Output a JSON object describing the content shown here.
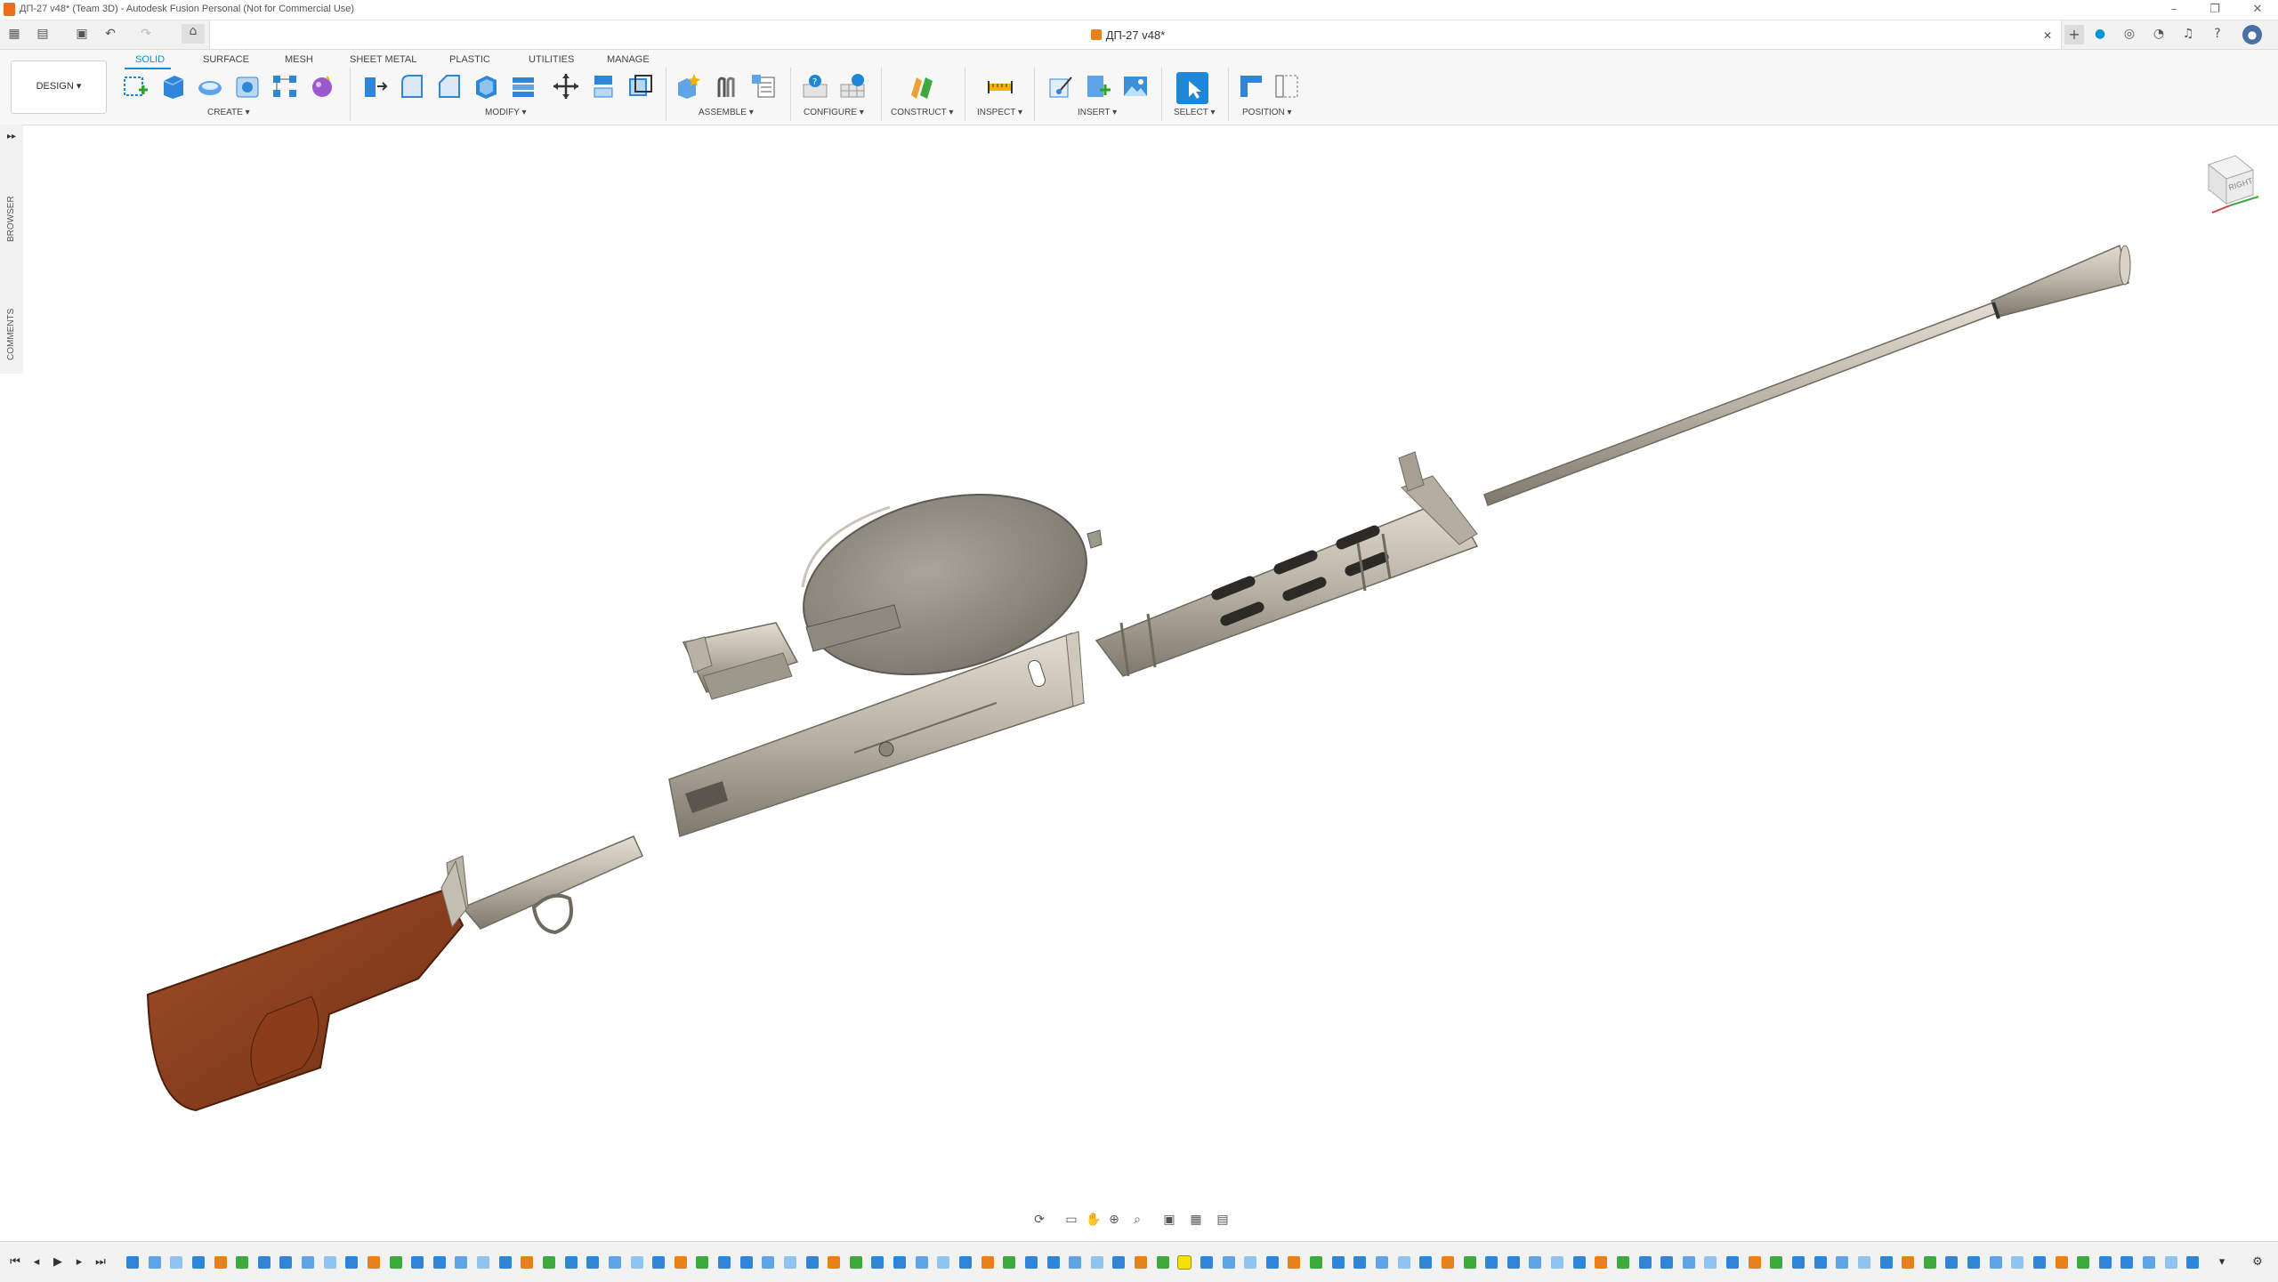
{
  "window": {
    "title": "ДП-27 v48* (Team 3D) - Autodesk Fusion Personal (Not for Commercial Use)",
    "controls": [
      "minimize",
      "restore",
      "close"
    ]
  },
  "document_tab": {
    "label": "ДП-27 v48*",
    "icon": "component-box-icon"
  },
  "workspace": {
    "label": "DESIGN ▾"
  },
  "ribbon_tabs": [
    {
      "label": "SOLID",
      "active": true
    },
    {
      "label": "SURFACE",
      "active": false
    },
    {
      "label": "MESH",
      "active": false
    },
    {
      "label": "SHEET METAL",
      "active": false
    },
    {
      "label": "PLASTIC",
      "active": false
    },
    {
      "label": "UTILITIES",
      "active": false
    },
    {
      "label": "MANAGE",
      "active": false
    }
  ],
  "ribbon_groups": [
    {
      "label": "CREATE ▾"
    },
    {
      "label": "MODIFY ▾"
    },
    {
      "label": "ASSEMBLE ▾"
    },
    {
      "label": "CONFIGURE ▾"
    },
    {
      "label": "CONSTRUCT ▾"
    },
    {
      "label": "INSPECT ▾"
    },
    {
      "label": "INSERT ▾"
    },
    {
      "label": "SELECT ▾"
    },
    {
      "label": "POSITION ▾"
    }
  ],
  "side_panels": {
    "browser_label": "BROWSER",
    "comments_label": "COMMENTS"
  },
  "viewcube": {
    "face_label": "RIGHT"
  },
  "colors": {
    "accent": "#0696d7",
    "metal": "#b9b3a6",
    "metal_dark": "#8a8478",
    "wood": "#8b3f1f",
    "magazine": "#8f8a80",
    "select_blue": "#1e88d8"
  },
  "timeline": {
    "controls": [
      "skip-start",
      "step-back",
      "play",
      "step-forward",
      "skip-end"
    ],
    "feature_count": 95
  }
}
